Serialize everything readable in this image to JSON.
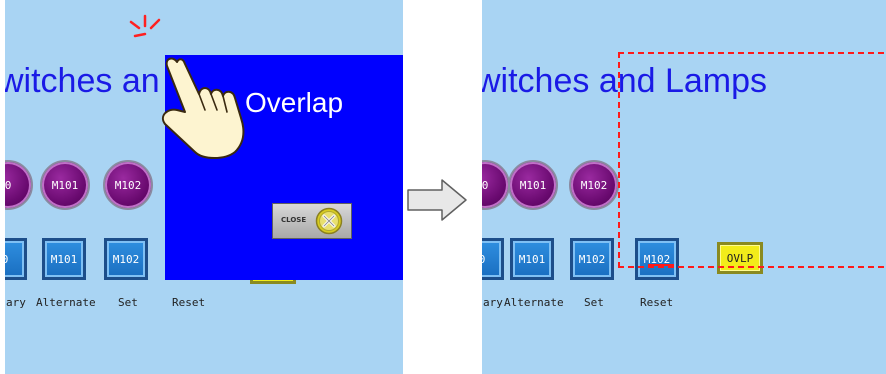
{
  "left": {
    "title": "witches an",
    "lamps": [
      "0",
      "M101",
      "M102"
    ],
    "switches": [
      "0",
      "M101",
      "M102"
    ],
    "switch_labels": [
      "ary",
      "Alternate",
      "Set",
      "Reset"
    ],
    "overlap": {
      "title": "Overlap",
      "close_label": "CLOSE"
    }
  },
  "right": {
    "title": "witches and Lamps",
    "lamps": [
      "0",
      "M101",
      "M102"
    ],
    "switches": [
      "0",
      "M101",
      "M102"
    ],
    "ovlp_label": "OVLP",
    "switch_labels": [
      "ary",
      "Alternate",
      "Set",
      "Reset"
    ]
  },
  "colors": {
    "panel_bg": "#a9d4f3",
    "title": "#1a1ae6",
    "overlap_bg": "#0000ff",
    "dashed": "#ff1a1a"
  },
  "icons": {
    "hand": "pointing-hand-icon",
    "arrow": "right-arrow-icon",
    "close": "close-icon",
    "tap": "tap-indicator-icon"
  }
}
